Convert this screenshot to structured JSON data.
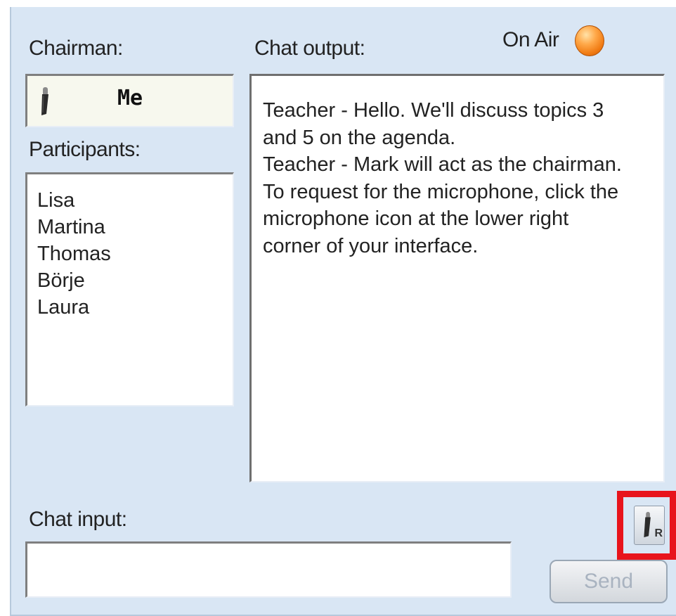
{
  "chairman": {
    "label": "Chairman:",
    "name": "Me"
  },
  "participants": {
    "label": "Participants:",
    "items": [
      "Lisa",
      "Martina",
      "Thomas",
      "Börje",
      "Laura"
    ]
  },
  "chat_output": {
    "label": "Chat output:",
    "on_air_label": "On Air",
    "on_air_color": "#f07a12",
    "lines": [
      "Teacher - Hello. We'll discuss topics 3",
      "and 5 on the agenda.",
      "Teacher - Mark will act as the chairman.",
      "To request for the microphone, click the",
      "microphone icon at the lower right",
      "corner of your interface."
    ]
  },
  "chat_input": {
    "label": "Chat input:",
    "value": ""
  },
  "buttons": {
    "send_label": "Send",
    "mic_request_badge": "R"
  },
  "icons": {
    "chairman": "microphone-icon",
    "request": "microphone-request-icon"
  },
  "highlight_color": "#e8141c"
}
